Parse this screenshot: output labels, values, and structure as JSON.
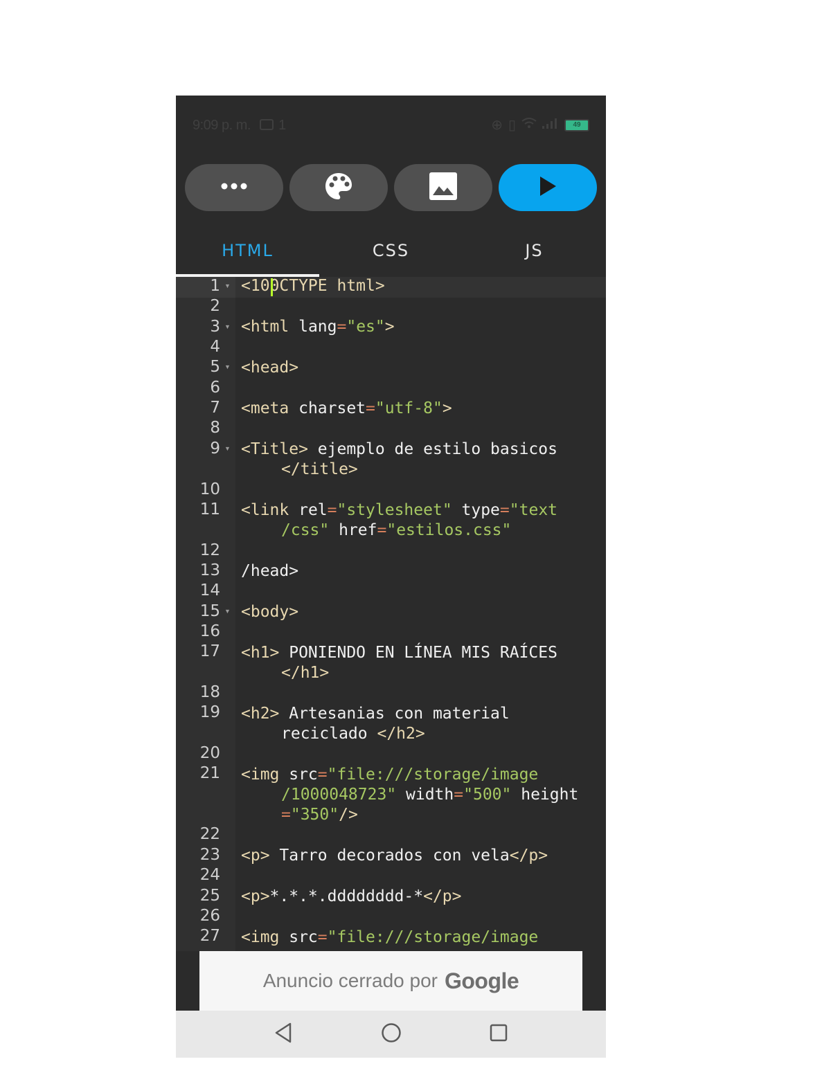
{
  "status_bar": {
    "time": "9:09 p. m.",
    "notification_count": "1",
    "battery_level": "49",
    "icons": [
      "message-icon",
      "hotspot-icon",
      "vibrate-icon",
      "wifi-icon",
      "signal-icon",
      "battery-icon"
    ]
  },
  "toolbar": {
    "buttons": [
      {
        "name": "more-options",
        "icon": "ellipsis-icon"
      },
      {
        "name": "theme",
        "icon": "palette-icon"
      },
      {
        "name": "images",
        "icon": "image-icon"
      },
      {
        "name": "run",
        "icon": "play-icon",
        "color": "#08a4ee"
      }
    ]
  },
  "tabs": [
    {
      "label": "HTML",
      "active": true
    },
    {
      "label": "CSS",
      "active": false
    },
    {
      "label": "JS",
      "active": false
    }
  ],
  "colors": {
    "accent": "#2aa9e9",
    "background": "#2b2b2b",
    "string": "#a6c862",
    "tag": "#e8d8b0",
    "operator": "#d67f5c"
  },
  "editor": {
    "line_numbers": [
      "1",
      "2",
      "3",
      "4",
      "5",
      "6",
      "7",
      "8",
      "9",
      "10",
      "11",
      "12",
      "13",
      "14",
      "15",
      "16",
      "17",
      "18",
      "19",
      "20",
      "21",
      "22",
      "23",
      "24",
      "25",
      "26",
      "27"
    ],
    "lines": {
      "l1": {
        "a": "<10",
        "b": "0CTYPE html>"
      },
      "l3": {
        "a": "<html",
        "b": " lang",
        "c": "=",
        "d": "\"es\"",
        "e": ">"
      },
      "l5": {
        "a": "<head>"
      },
      "l7": {
        "a": "<meta",
        "b": " charset",
        "c": "=",
        "d": "\"utf-8\"",
        "e": ">"
      },
      "l9": {
        "a": "<Title>",
        "b": " ejemplo de estilo basicos",
        "c": "</title>"
      },
      "l11": {
        "a": "<link",
        "b": " rel",
        "c": "=",
        "d": "\"stylesheet\"",
        "e": " type",
        "f": "=",
        "g": "\"text",
        "h": "/css\"",
        "i": " href",
        "j": "=",
        "k": "\"estilos.css\""
      },
      "l13": {
        "a": "/head>"
      },
      "l15": {
        "a": "<body>"
      },
      "l17": {
        "a": "<h1>",
        "b": " PONIENDO EN LÍNEA MIS RAÍCES",
        "c": "</h1>"
      },
      "l19": {
        "a": "<h2>",
        "b": " Artesanias con material",
        "c": "reciclado ",
        "d": "</h2>"
      },
      "l21": {
        "a": "<img",
        "b": " src",
        "c": "=",
        "d": "\"file:///storage/image",
        "e": "/1000048723\"",
        "f": " width",
        "g": "=",
        "h": "\"500\"",
        "i": " height",
        "j": "=",
        "k": "\"350\"",
        "l": "/>"
      },
      "l23": {
        "a": "<p>",
        "b": " Tarro decorados con vela",
        "c": "</p>"
      },
      "l25": {
        "a": "<p>",
        "b": "*.*.*.dddddddd-*",
        "c": "</p>"
      },
      "l27": {
        "a": "<img",
        "b": " src",
        "c": "=",
        "d": "\"file:///storage/image"
      }
    }
  },
  "ad": {
    "text": "Anuncio cerrado por",
    "brand": "Google"
  },
  "nav_bar": {
    "buttons": [
      "back-icon",
      "home-icon",
      "recents-icon"
    ]
  }
}
